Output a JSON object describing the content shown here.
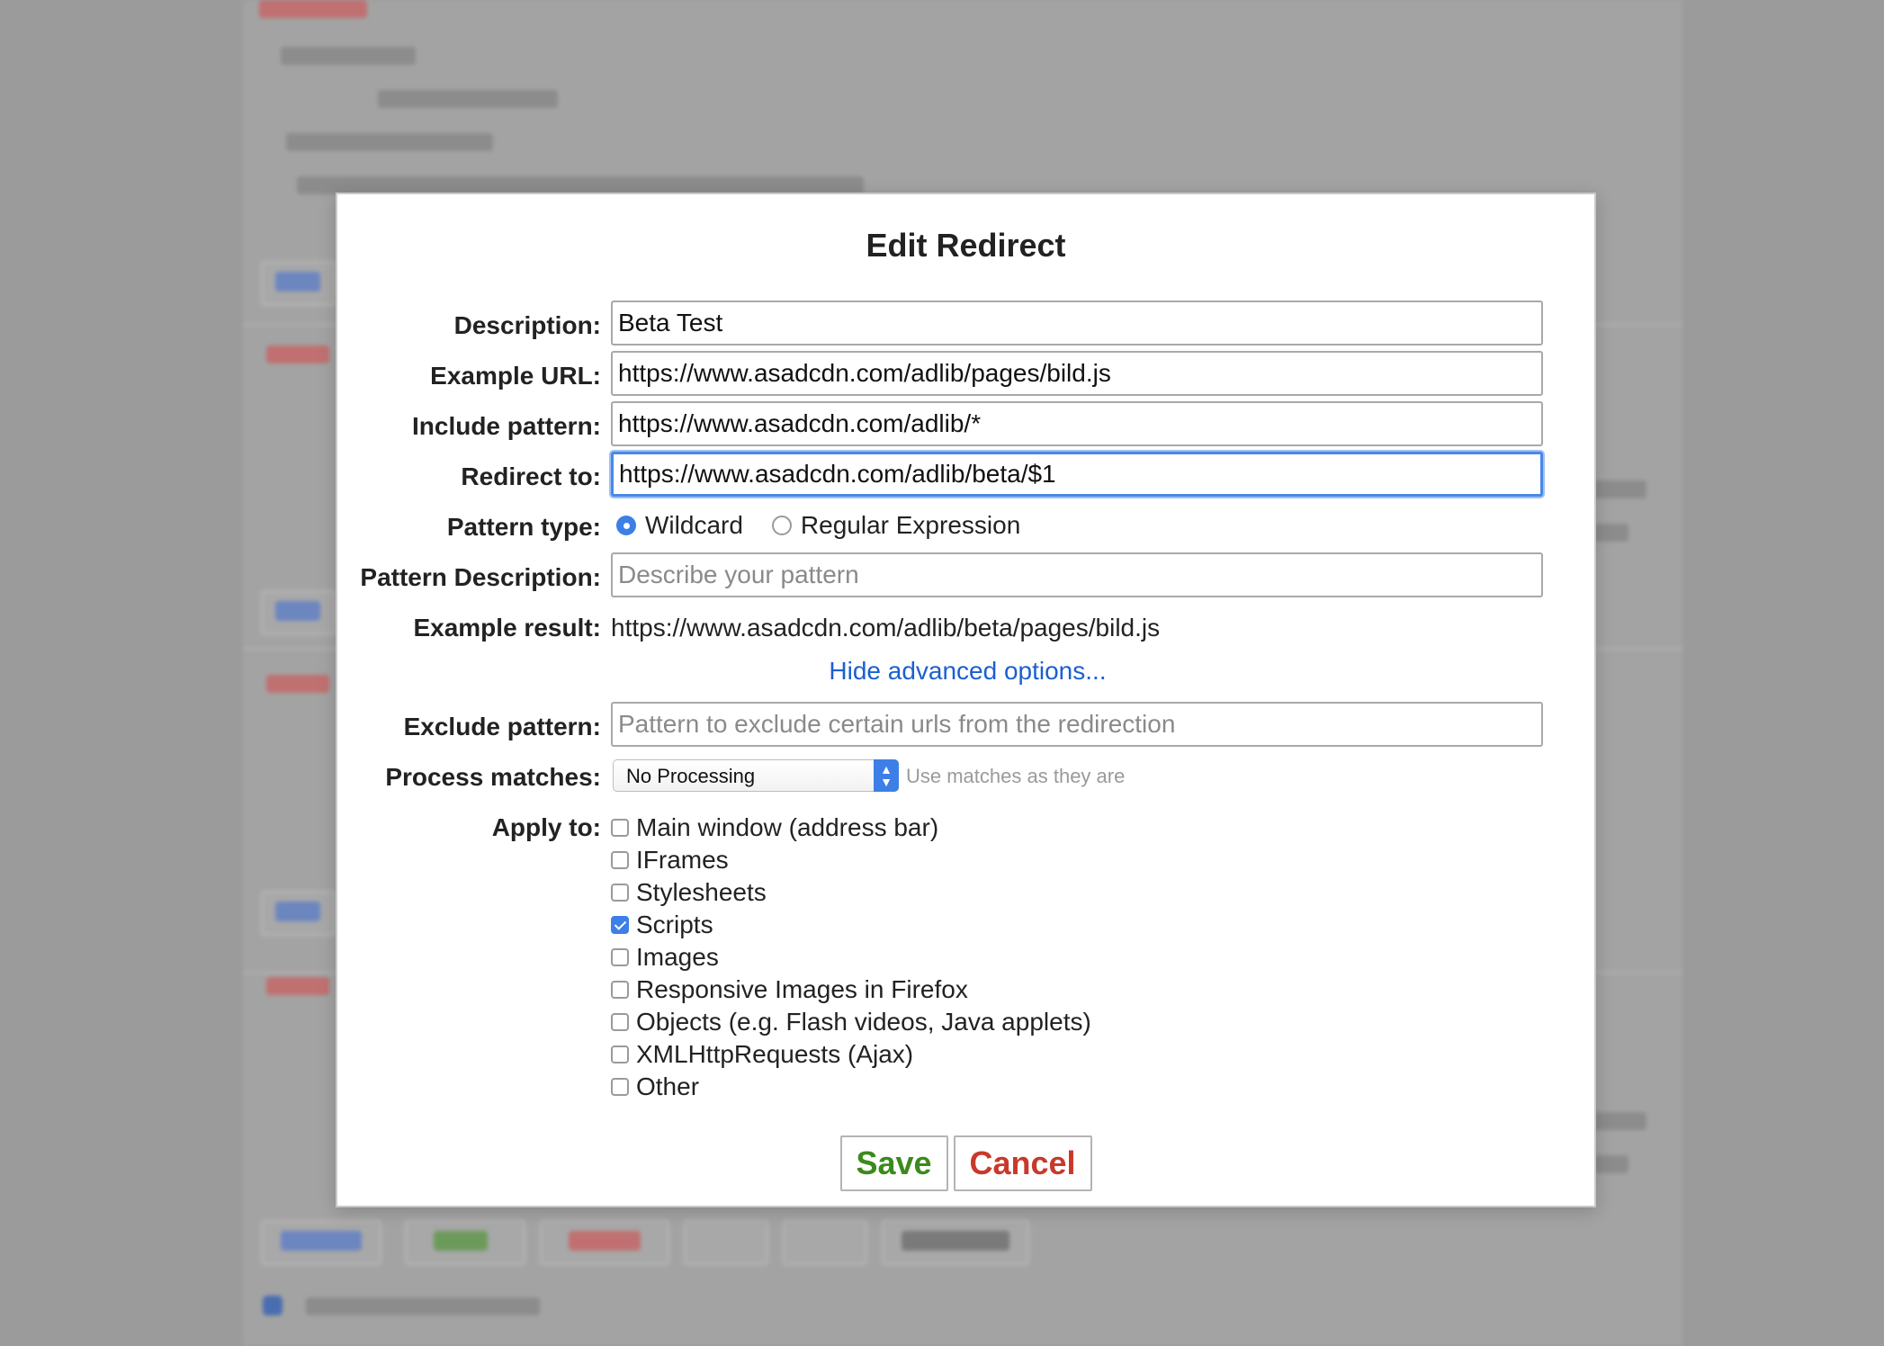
{
  "dialog": {
    "title": "Edit Redirect",
    "description": {
      "label": "Description:",
      "value": "Beta Test"
    },
    "example_url": {
      "label": "Example URL:",
      "value": "https://www.asadcdn.com/adlib/pages/bild.js"
    },
    "include_pattern": {
      "label": "Include pattern:",
      "value": "https://www.asadcdn.com/adlib/*"
    },
    "redirect_to": {
      "label": "Redirect to:",
      "value": "https://www.asadcdn.com/adlib/beta/$1"
    },
    "pattern_type": {
      "label": "Pattern type:",
      "options": [
        "Wildcard",
        "Regular Expression"
      ],
      "selected": "Wildcard"
    },
    "pattern_description": {
      "label": "Pattern Description:",
      "placeholder": "Describe your pattern"
    },
    "example_result": {
      "label": "Example result:",
      "value": "https://www.asadcdn.com/adlib/beta/pages/bild.js"
    },
    "advanced_link": "Hide advanced options...",
    "exclude_pattern": {
      "label": "Exclude pattern:",
      "placeholder": "Pattern to exclude certain urls from the redirection"
    },
    "process_matches": {
      "label": "Process matches:",
      "selected": "No Processing",
      "hint": "Use matches as they are"
    },
    "apply_to": {
      "label": "Apply to:",
      "items": [
        {
          "label": "Main window (address bar)",
          "checked": false
        },
        {
          "label": "IFrames",
          "checked": false
        },
        {
          "label": "Stylesheets",
          "checked": false
        },
        {
          "label": "Scripts",
          "checked": true
        },
        {
          "label": "Images",
          "checked": false
        },
        {
          "label": "Responsive Images in Firefox",
          "checked": false
        },
        {
          "label": "Objects (e.g. Flash videos, Java applets)",
          "checked": false
        },
        {
          "label": "XMLHttpRequests (Ajax)",
          "checked": false
        },
        {
          "label": "Other",
          "checked": false
        }
      ]
    },
    "buttons": {
      "save": "Save",
      "cancel": "Cancel"
    }
  },
  "colors": {
    "accent": "#3d7fe6",
    "link": "#1a5fd0",
    "save": "#3b8a1c",
    "cancel": "#c8392b",
    "overlay": "#9b9b9b"
  }
}
